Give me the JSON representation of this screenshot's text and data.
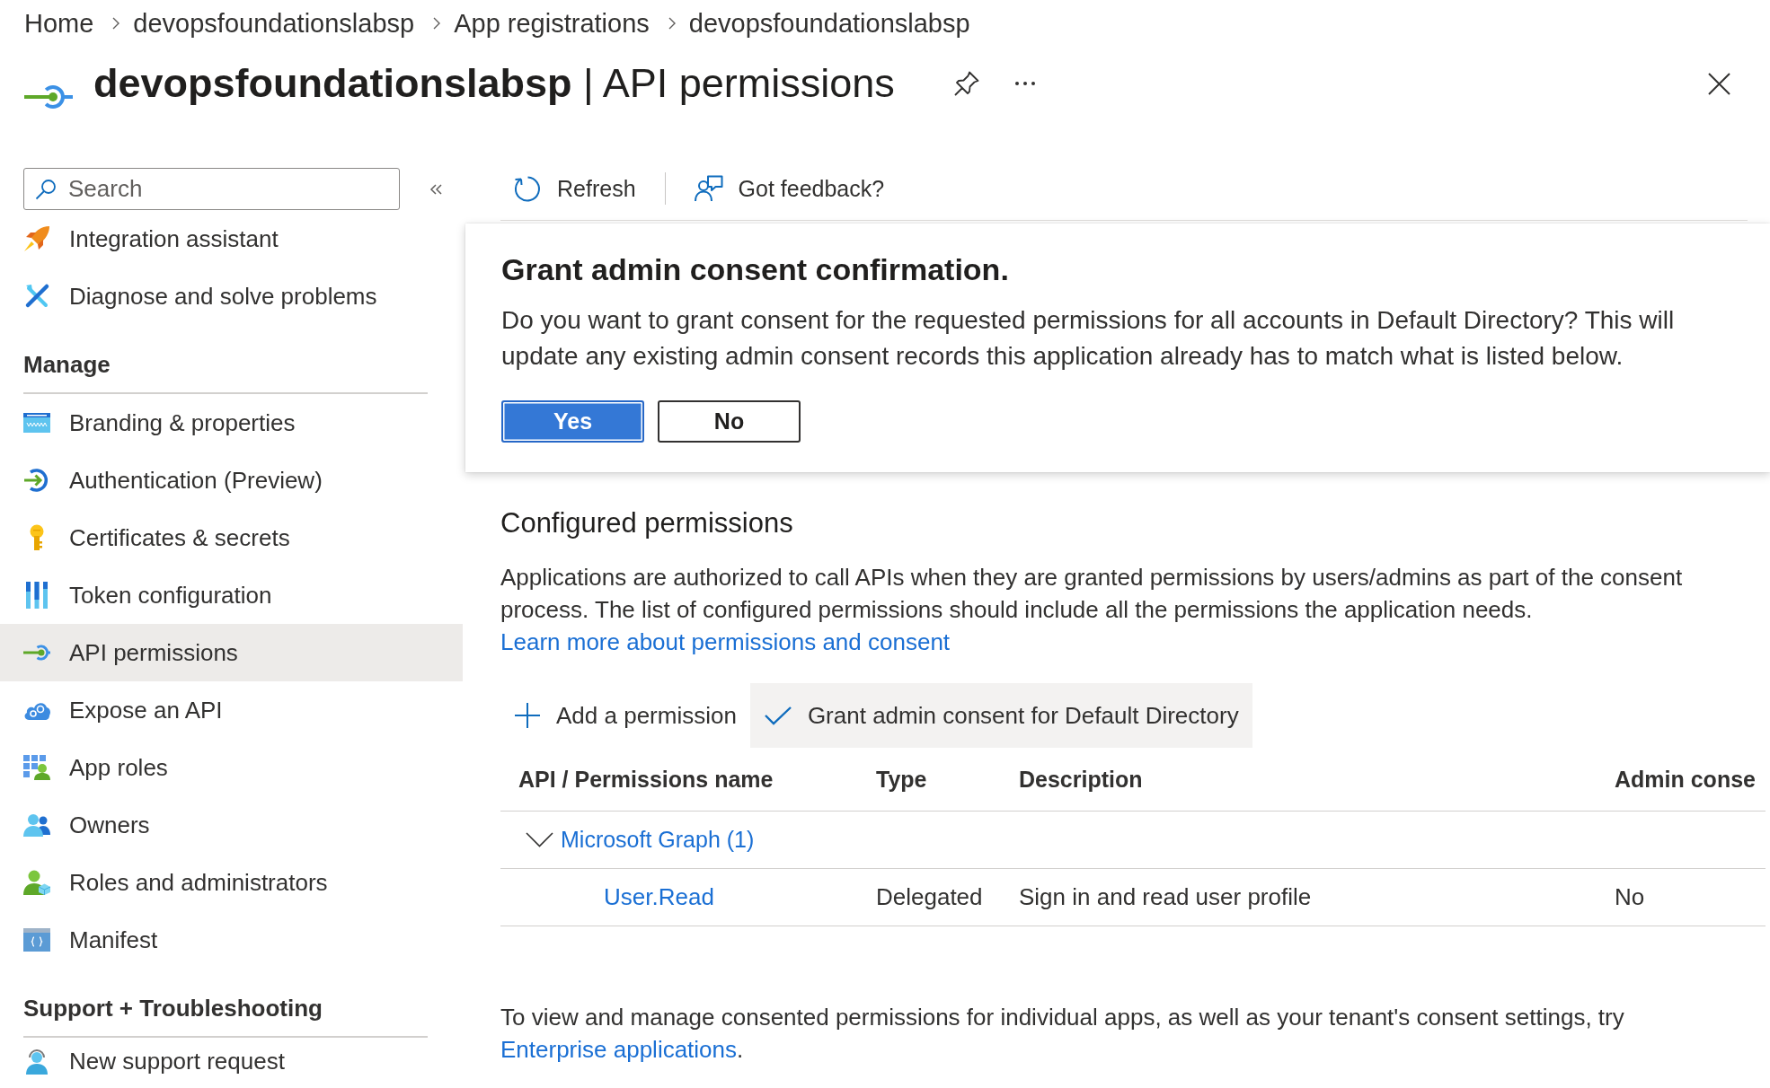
{
  "breadcrumb": [
    {
      "label": "Home"
    },
    {
      "label": "devopsfoundationslabsp"
    },
    {
      "label": "App registrations"
    },
    {
      "label": "devopsfoundationslabsp"
    }
  ],
  "header": {
    "title": "**devopsfoundationslabsp** | API permissions"
  },
  "sidebar": {
    "search": {
      "placeholder": "Search"
    },
    "sections": [
      {
        "items": [
          {
            "label": "Integration assistant",
            "selected": false
          },
          {
            "label": "Diagnose and solve problems",
            "selected": false
          }
        ]
      },
      {
        "heading": "Manage",
        "items": [
          {
            "label": "Branding & properties",
            "selected": false
          },
          {
            "label": "Authentication (Preview)",
            "selected": false
          },
          {
            "label": "Certificates & secrets",
            "selected": false
          },
          {
            "label": "Token configuration",
            "selected": false
          },
          {
            "label": "API permissions",
            "selected": true
          },
          {
            "label": "Expose an API",
            "selected": false
          },
          {
            "label": "App roles",
            "selected": false
          },
          {
            "label": "Owners",
            "selected": false
          },
          {
            "label": "Roles and administrators",
            "selected": false
          },
          {
            "label": "Manifest",
            "selected": false
          }
        ]
      },
      {
        "heading": "Support + Troubleshooting",
        "items": [
          {
            "label": "New support request",
            "selected": false
          }
        ]
      }
    ]
  },
  "toolbar": [
    {
      "label": "Refresh"
    },
    {
      "label": "Got feedback?"
    }
  ],
  "dialog": {
    "title": "Grant admin consent confirmation.",
    "message": "Do you want to grant consent for the requested permissions for all accounts in Default Directory? This will update any existing admin consent records this application already has to match what is listed below.",
    "buttons": [
      {
        "label": "Yes",
        "kind": "primary"
      },
      {
        "label": "No",
        "kind": "secondary"
      }
    ]
  },
  "configured_permissions": {
    "heading": "Configured permissions",
    "description": "Applications are authorized to call APIs when they are granted permissions by users/admins as part of the consent process. The list of configured permissions should include all the permissions the application needs.",
    "link": "Learn more about permissions and consent"
  },
  "commands": [
    {
      "label": "Add a permission",
      "highlighted": false
    },
    {
      "label": "Grant admin consent for Default Directory",
      "highlighted": true
    }
  ],
  "table": {
    "columns": [
      "API / Permissions name",
      "Type",
      "Description",
      "Admin conse"
    ],
    "groups": [
      {
        "name": "Microsoft Graph (1)",
        "expanded": true,
        "rows": [
          {
            "cells": [
              "User.Read",
              "Delegated",
              "Sign in and read user profile",
              "No"
            ]
          }
        ]
      }
    ]
  },
  "footer": {
    "text": "To view and manage consented permissions for individual apps, as well as your tenant's consent settings, try",
    "link": "Enterprise applications",
    "suffix": "."
  }
}
